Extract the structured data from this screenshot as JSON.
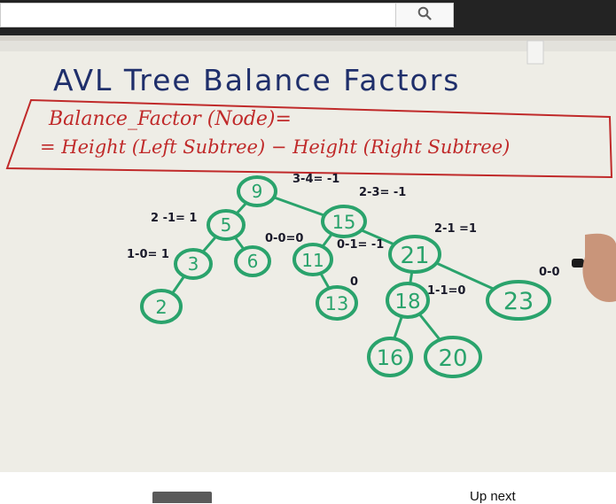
{
  "search": {
    "value": "",
    "placeholder": ""
  },
  "whiteboard": {
    "title": "AVL Tree Balance Factors",
    "formula_line1": "Balance_Factor (Node)=",
    "formula_line2": "= Height (Left Subtree) − Height (Right Subtree)",
    "nodes": [
      "9",
      "5",
      "15",
      "3",
      "6",
      "11",
      "21",
      "2",
      "13",
      "18",
      "23",
      "16",
      "20"
    ],
    "annotations": {
      "n9": "3-4= -1",
      "n5": "2 -1= 1",
      "n15": "2-3= -1",
      "n3": "1-0= 1",
      "n11": "0-1= -1",
      "n6": "0-0=0",
      "n21": "2-1 =1",
      "n13": "0",
      "n18": "1-1=0",
      "n23": "0-0"
    }
  },
  "sidebar": {
    "up_next_label": "Up next"
  },
  "colors": {
    "marker_blue": "#1f2f6b",
    "marker_red": "#c02a2a",
    "marker_green": "#2aa36c",
    "board": "#eeede6"
  }
}
